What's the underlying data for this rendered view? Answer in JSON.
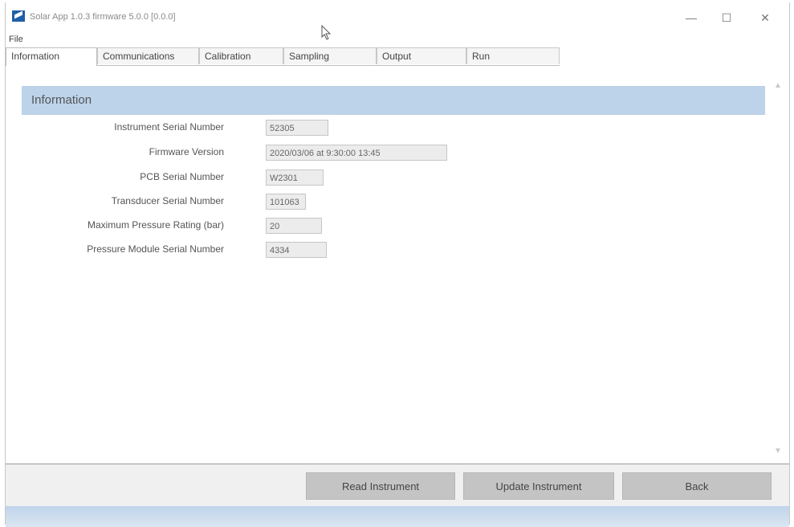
{
  "window": {
    "title": "Solar App 1.0.3 firmware 5.0.0 [0.0.0]"
  },
  "menu": {
    "file_label": "File"
  },
  "tabs": [
    {
      "label": "Information",
      "active": true
    },
    {
      "label": "Communications",
      "active": false
    },
    {
      "label": "Calibration",
      "active": false
    },
    {
      "label": "Sampling",
      "active": false
    },
    {
      "label": "Output",
      "active": false
    },
    {
      "label": "Run",
      "active": false
    }
  ],
  "section": {
    "title": "Information",
    "fields": [
      {
        "label": "Instrument Serial Number",
        "value": "52305"
      },
      {
        "label": "Firmware Version",
        "value": "2020/03/06 at 9:30:00 13:45"
      },
      {
        "label": "PCB Serial Number",
        "value": "W2301"
      },
      {
        "label": "Transducer Serial Number",
        "value": "101063"
      },
      {
        "label": "Maximum Pressure Rating (bar)",
        "value": "20"
      },
      {
        "label": "Pressure Module Serial Number",
        "value": "4334"
      }
    ]
  },
  "footer": {
    "read_button": "Read Instrument",
    "update_button": "Update Instrument",
    "back_button": "Back"
  },
  "colors": {
    "header_bg": "#bcd3ea",
    "button_bg": "#c4c4c4",
    "accent": "#1f5fa8"
  }
}
